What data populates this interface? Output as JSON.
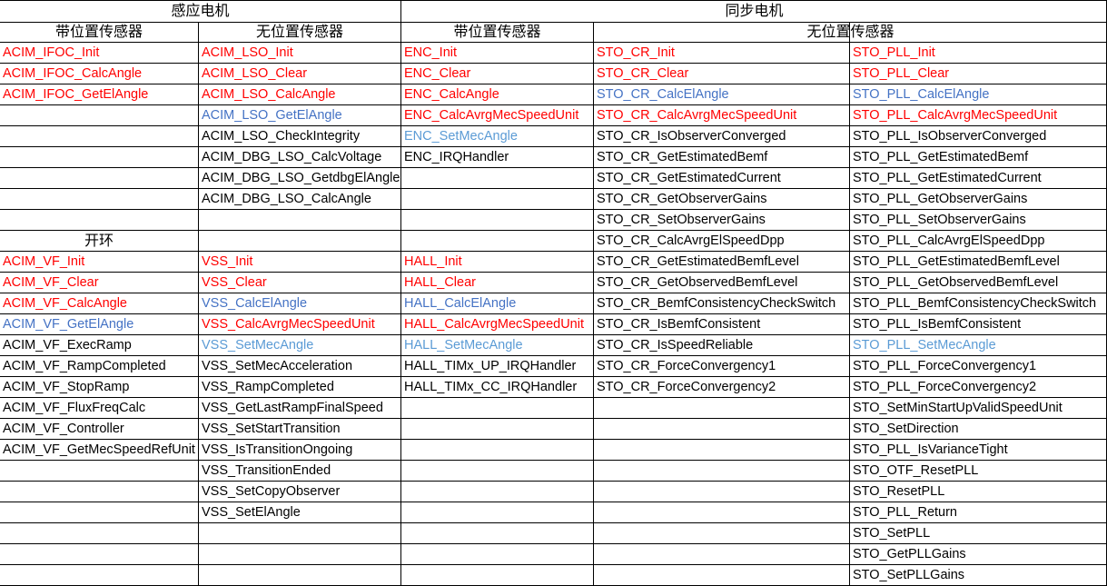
{
  "headers": {
    "induction_motor": "感应电机",
    "synchronous_motor": "同步电机",
    "acim_with_sensor": "带位置传感器",
    "acim_sensorless": "无位置传感器",
    "sync_with_sensor": "带位置传感器",
    "sync_sensorless": "无位置传感器",
    "open_loop": "开环"
  },
  "colors": {
    "black": "#000000",
    "red": "#ff0000",
    "blue": "#4472c4",
    "light_blue": "#5b9bd5"
  },
  "columns": [
    {
      "key": "acim_with_sensor",
      "items": [
        {
          "row": 0,
          "text": "ACIM_IFOC_Init",
          "color": "red"
        },
        {
          "row": 1,
          "text": "ACIM_IFOC_CalcAngle",
          "color": "red"
        },
        {
          "row": 2,
          "text": "ACIM_IFOC_GetElAngle",
          "color": "red"
        },
        {
          "row": 10,
          "text": "ACIM_VF_Init",
          "color": "red"
        },
        {
          "row": 11,
          "text": "ACIM_VF_Clear",
          "color": "red"
        },
        {
          "row": 12,
          "text": "ACIM_VF_CalcAngle",
          "color": "red"
        },
        {
          "row": 13,
          "text": "ACIM_VF_GetElAngle",
          "color": "blue"
        },
        {
          "row": 14,
          "text": "ACIM_VF_ExecRamp",
          "color": "black"
        },
        {
          "row": 15,
          "text": "ACIM_VF_RampCompleted",
          "color": "black"
        },
        {
          "row": 16,
          "text": "ACIM_VF_StopRamp",
          "color": "black"
        },
        {
          "row": 17,
          "text": "ACIM_VF_FluxFreqCalc",
          "color": "black"
        },
        {
          "row": 18,
          "text": "ACIM_VF_Controller",
          "color": "black"
        },
        {
          "row": 19,
          "text": "ACIM_VF_GetMecSpeedRefUnit",
          "color": "black"
        }
      ]
    },
    {
      "key": "acim_sensorless",
      "items": [
        {
          "row": 0,
          "text": "ACIM_LSO_Init",
          "color": "red"
        },
        {
          "row": 1,
          "text": "ACIM_LSO_Clear",
          "color": "red"
        },
        {
          "row": 2,
          "text": "ACIM_LSO_CalcAngle",
          "color": "red"
        },
        {
          "row": 3,
          "text": "ACIM_LSO_GetElAngle",
          "color": "blue"
        },
        {
          "row": 4,
          "text": "ACIM_LSO_CheckIntegrity",
          "color": "black"
        },
        {
          "row": 5,
          "text": "ACIM_DBG_LSO_CalcVoltage",
          "color": "black"
        },
        {
          "row": 6,
          "text": "ACIM_DBG_LSO_GetdbgElAngle",
          "color": "black"
        },
        {
          "row": 7,
          "text": "ACIM_DBG_LSO_CalcAngle",
          "color": "black"
        },
        {
          "row": 10,
          "text": "VSS_Init",
          "color": "red"
        },
        {
          "row": 11,
          "text": "VSS_Clear",
          "color": "red"
        },
        {
          "row": 12,
          "text": "VSS_CalcElAngle",
          "color": "blue"
        },
        {
          "row": 13,
          "text": "VSS_CalcAvrgMecSpeedUnit",
          "color": "red"
        },
        {
          "row": 14,
          "text": "VSS_SetMecAngle",
          "color": "light_blue"
        },
        {
          "row": 15,
          "text": "VSS_SetMecAcceleration",
          "color": "black"
        },
        {
          "row": 16,
          "text": "VSS_RampCompleted",
          "color": "black"
        },
        {
          "row": 17,
          "text": "VSS_GetLastRampFinalSpeed",
          "color": "black"
        },
        {
          "row": 18,
          "text": "VSS_SetStartTransition",
          "color": "black"
        },
        {
          "row": 19,
          "text": "VSS_IsTransitionOngoing",
          "color": "black"
        },
        {
          "row": 20,
          "text": "VSS_TransitionEnded",
          "color": "black"
        },
        {
          "row": 21,
          "text": "VSS_SetCopyObserver",
          "color": "black"
        },
        {
          "row": 22,
          "text": "VSS_SetElAngle",
          "color": "black"
        }
      ]
    },
    {
      "key": "sync_with_sensor",
      "items": [
        {
          "row": 0,
          "text": "ENC_Init",
          "color": "red"
        },
        {
          "row": 1,
          "text": "ENC_Clear",
          "color": "red"
        },
        {
          "row": 2,
          "text": "ENC_CalcAngle",
          "color": "red"
        },
        {
          "row": 3,
          "text": "ENC_CalcAvrgMecSpeedUnit",
          "color": "red"
        },
        {
          "row": 4,
          "text": "ENC_SetMecAngle",
          "color": "light_blue"
        },
        {
          "row": 5,
          "text": "ENC_IRQHandler",
          "color": "black"
        },
        {
          "row": 10,
          "text": "HALL_Init",
          "color": "red"
        },
        {
          "row": 11,
          "text": "HALL_Clear",
          "color": "red"
        },
        {
          "row": 12,
          "text": "HALL_CalcElAngle",
          "color": "blue"
        },
        {
          "row": 13,
          "text": "HALL_CalcAvrgMecSpeedUnit",
          "color": "red"
        },
        {
          "row": 14,
          "text": "HALL_SetMecAngle",
          "color": "light_blue"
        },
        {
          "row": 15,
          "text": "HALL_TIMx_UP_IRQHandler",
          "color": "black"
        },
        {
          "row": 16,
          "text": "HALL_TIMx_CC_IRQHandler",
          "color": "black"
        }
      ]
    },
    {
      "key": "sync_sensorless_cr",
      "items": [
        {
          "row": 0,
          "text": "STO_CR_Init",
          "color": "red"
        },
        {
          "row": 1,
          "text": "STO_CR_Clear",
          "color": "red"
        },
        {
          "row": 2,
          "text": "STO_CR_CalcElAngle",
          "color": "blue"
        },
        {
          "row": 3,
          "text": "STO_CR_CalcAvrgMecSpeedUnit",
          "color": "red"
        },
        {
          "row": 4,
          "text": "STO_CR_IsObserverConverged",
          "color": "black"
        },
        {
          "row": 5,
          "text": "STO_CR_GetEstimatedBemf",
          "color": "black"
        },
        {
          "row": 6,
          "text": "STO_CR_GetEstimatedCurrent",
          "color": "black"
        },
        {
          "row": 7,
          "text": "STO_CR_GetObserverGains",
          "color": "black"
        },
        {
          "row": 8,
          "text": "STO_CR_SetObserverGains",
          "color": "black"
        },
        {
          "row": 9,
          "text": "STO_CR_CalcAvrgElSpeedDpp",
          "color": "black"
        },
        {
          "row": 10,
          "text": "STO_CR_GetEstimatedBemfLevel",
          "color": "black"
        },
        {
          "row": 11,
          "text": "STO_CR_GetObservedBemfLevel",
          "color": "black"
        },
        {
          "row": 12,
          "text": "STO_CR_BemfConsistencyCheckSwitch",
          "color": "black"
        },
        {
          "row": 13,
          "text": "STO_CR_IsBemfConsistent",
          "color": "black"
        },
        {
          "row": 14,
          "text": "STO_CR_IsSpeedReliable",
          "color": "black"
        },
        {
          "row": 15,
          "text": "STO_CR_ForceConvergency1",
          "color": "black"
        },
        {
          "row": 16,
          "text": "STO_CR_ForceConvergency2",
          "color": "black"
        }
      ]
    },
    {
      "key": "sync_sensorless_pll",
      "items": [
        {
          "row": 0,
          "text": "STO_PLL_Init",
          "color": "red"
        },
        {
          "row": 1,
          "text": "STO_PLL_Clear",
          "color": "red"
        },
        {
          "row": 2,
          "text": "STO_PLL_CalcElAngle",
          "color": "blue"
        },
        {
          "row": 3,
          "text": "STO_PLL_CalcAvrgMecSpeedUnit",
          "color": "red"
        },
        {
          "row": 4,
          "text": "STO_PLL_IsObserverConverged",
          "color": "black"
        },
        {
          "row": 5,
          "text": "STO_PLL_GetEstimatedBemf",
          "color": "black"
        },
        {
          "row": 6,
          "text": "STO_PLL_GetEstimatedCurrent",
          "color": "black"
        },
        {
          "row": 7,
          "text": "STO_PLL_GetObserverGains",
          "color": "black"
        },
        {
          "row": 8,
          "text": "STO_PLL_SetObserverGains",
          "color": "black"
        },
        {
          "row": 9,
          "text": "STO_PLL_CalcAvrgElSpeedDpp",
          "color": "black"
        },
        {
          "row": 10,
          "text": "STO_PLL_GetEstimatedBemfLevel",
          "color": "black"
        },
        {
          "row": 11,
          "text": "STO_PLL_GetObservedBemfLevel",
          "color": "black"
        },
        {
          "row": 12,
          "text": "STO_PLL_BemfConsistencyCheckSwitch",
          "color": "black"
        },
        {
          "row": 13,
          "text": "STO_PLL_IsBemfConsistent",
          "color": "black"
        },
        {
          "row": 14,
          "text": "STO_PLL_SetMecAngle",
          "color": "light_blue"
        },
        {
          "row": 15,
          "text": "STO_PLL_ForceConvergency1",
          "color": "black"
        },
        {
          "row": 16,
          "text": "STO_PLL_ForceConvergency2",
          "color": "black"
        },
        {
          "row": 17,
          "text": "STO_SetMinStartUpValidSpeedUnit",
          "color": "black"
        },
        {
          "row": 18,
          "text": "STO_SetDirection",
          "color": "black"
        },
        {
          "row": 19,
          "text": "STO_PLL_IsVarianceTight",
          "color": "black"
        },
        {
          "row": 20,
          "text": "STO_OTF_ResetPLL",
          "color": "black"
        },
        {
          "row": 21,
          "text": "STO_ResetPLL",
          "color": "black"
        },
        {
          "row": 22,
          "text": "STO_PLL_Return",
          "color": "black"
        },
        {
          "row": 23,
          "text": "STO_SetPLL",
          "color": "black"
        },
        {
          "row": 24,
          "text": "STO_GetPLLGains",
          "color": "black"
        },
        {
          "row": 25,
          "text": "STO_SetPLLGains",
          "color": "black"
        }
      ]
    }
  ]
}
